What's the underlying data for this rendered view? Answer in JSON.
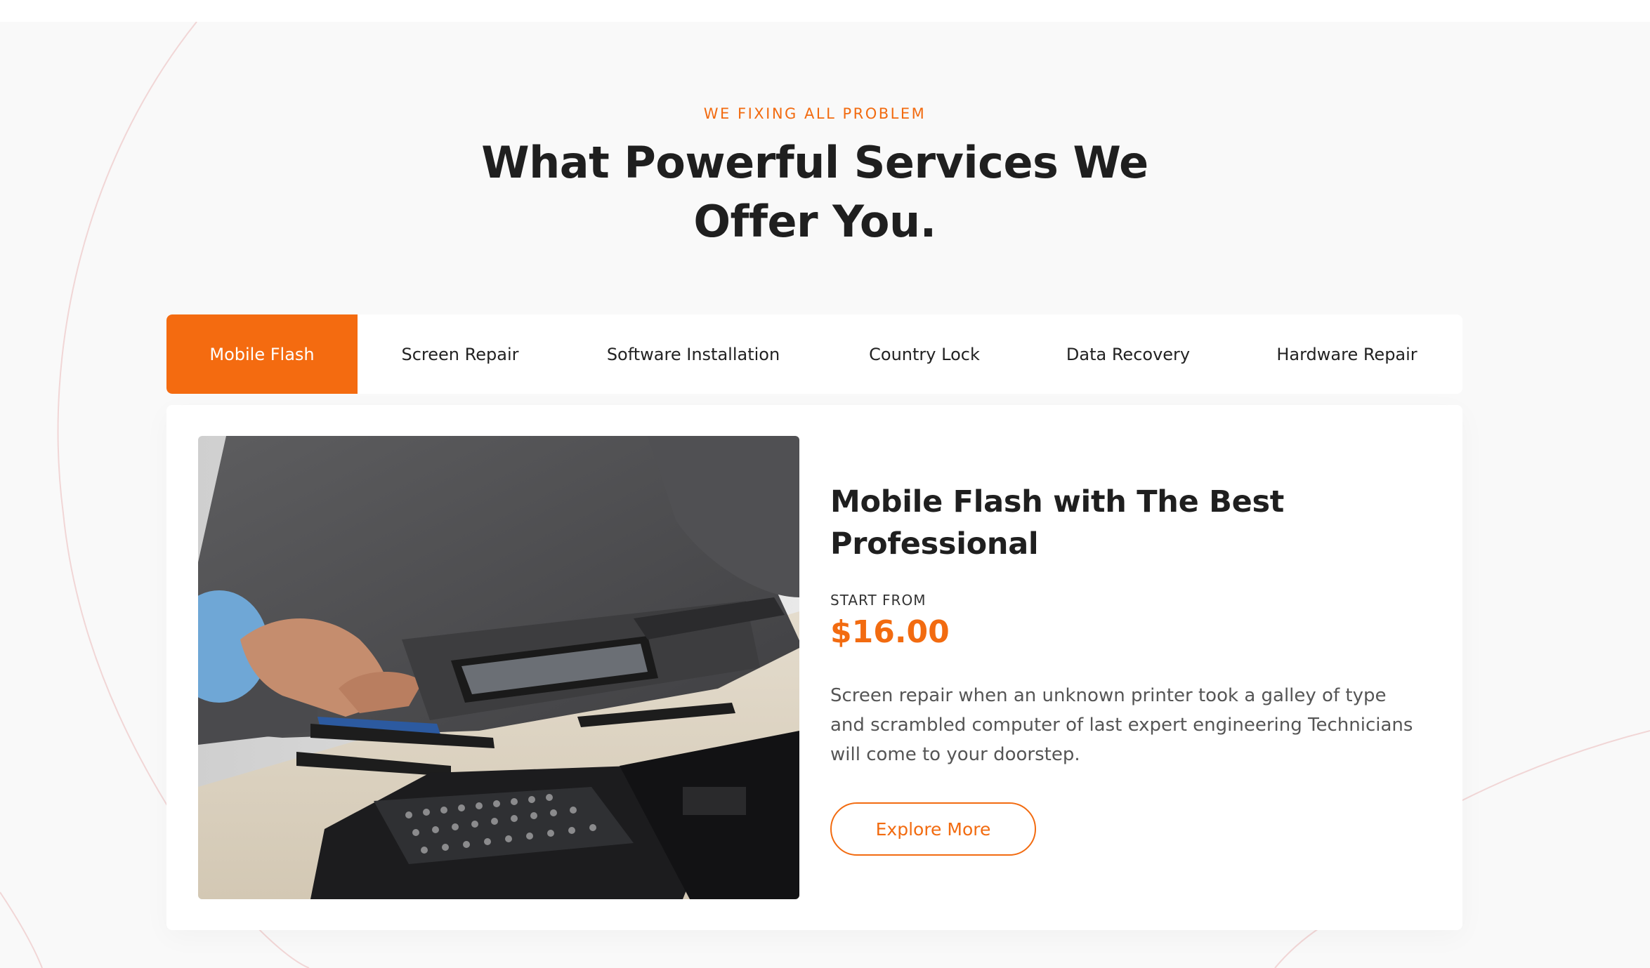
{
  "section": {
    "eyebrow": "WE FIXING ALL PROBLEM",
    "heading_line1": "What Powerful Services We",
    "heading_line2": "Offer You."
  },
  "tabs": [
    {
      "label": "Mobile Flash",
      "active": true
    },
    {
      "label": "Screen Repair",
      "active": false
    },
    {
      "label": "Software Installation",
      "active": false
    },
    {
      "label": "Country Lock",
      "active": false
    },
    {
      "label": "Data Recovery",
      "active": false
    },
    {
      "label": "Hardware Repair",
      "active": false
    }
  ],
  "service": {
    "title": "Mobile Flash with The Best Professional",
    "start_from_label": "START FROM",
    "price": "$16.00",
    "description": "Screen repair when an unknown printer took a galley of type and scrambled computer of last expert engineering Technicians will come to your doorstep.",
    "button_label": "Explore More"
  },
  "colors": {
    "accent": "#f46b10",
    "heading": "#1f1f1f",
    "body_text": "#555555",
    "section_background": "#f9f9f9"
  }
}
